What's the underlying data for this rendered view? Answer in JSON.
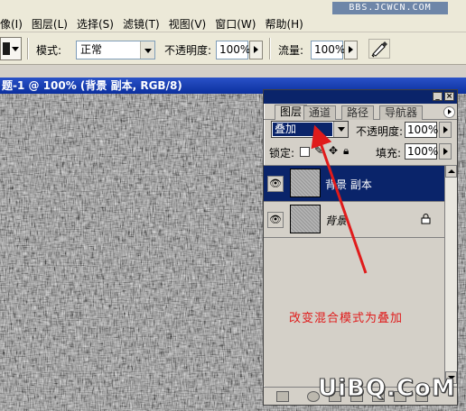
{
  "app": {
    "menu": [
      "像(I)",
      "图层(L)",
      "选择(S)",
      "滤镜(T)",
      "视图(V)",
      "窗口(W)",
      "帮助(H)"
    ],
    "watermark": "BBS.JCWCN.COM"
  },
  "options_bar": {
    "mode_label": "模式:",
    "mode_value": "正常",
    "opacity_label": "不透明度:",
    "opacity_value": "100%",
    "flow_label": "流量:",
    "flow_value": "100%",
    "airbrush_icon": "airbrush-icon"
  },
  "document": {
    "title": "题-1 @ 100% (背景 副本, RGB/8)"
  },
  "layers_palette": {
    "tabs": [
      "图层",
      "通道",
      "路径",
      "导航器"
    ],
    "active_tab": "图层",
    "blend_mode": "叠加",
    "opacity_label": "不透明度:",
    "opacity_value": "100%",
    "lock_label": "锁定:",
    "fill_label": "填充:",
    "fill_value": "100%",
    "layers": [
      {
        "name": "背景 副本",
        "selected": true,
        "visible": true,
        "locked": false
      },
      {
        "name": "背景",
        "selected": false,
        "visible": true,
        "locked": true
      }
    ]
  },
  "annotation": "改变混合模式为叠加",
  "brand": "UiBQ.CoM",
  "colors": {
    "title_bar": "#0a246a",
    "selection": "#0a246a",
    "annotation": "#e01b1b",
    "arrow": "#e01b1b"
  }
}
